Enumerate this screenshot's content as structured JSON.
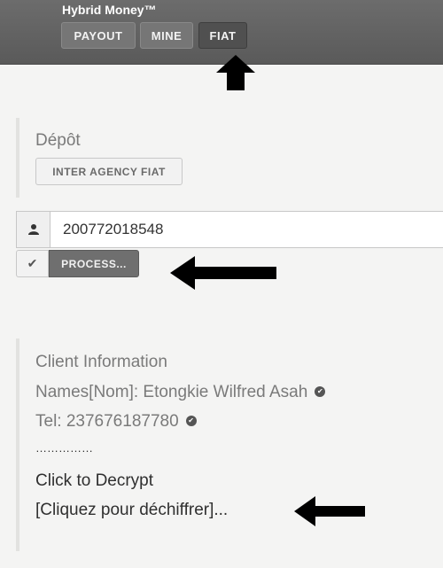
{
  "header": {
    "app_title": "Hybrid Money™",
    "tabs": [
      "PAYOUT",
      "MINE",
      "FIAT"
    ],
    "active_tab": "FIAT"
  },
  "depot": {
    "title": "Dépôt",
    "agency_button": "INTER AGENCY FIAT"
  },
  "form": {
    "user_icon": "user-icon",
    "code_value": "200772018548",
    "check_icon": "check-icon",
    "process_label": "PROCESS..."
  },
  "client": {
    "heading": "Client Information",
    "names": "Names[Nom]: Etongkie Wilfred Asah",
    "tel": "Tel: 237676187780",
    "dots": "……………",
    "decrypt_label": "Click to Decrypt",
    "decrypt_fr": "[Cliquez pour déchiffrer]..."
  },
  "colors": {
    "header_bg": "#5f5f5f",
    "active_tab_bg": "#505050",
    "arrow": "#000000"
  }
}
